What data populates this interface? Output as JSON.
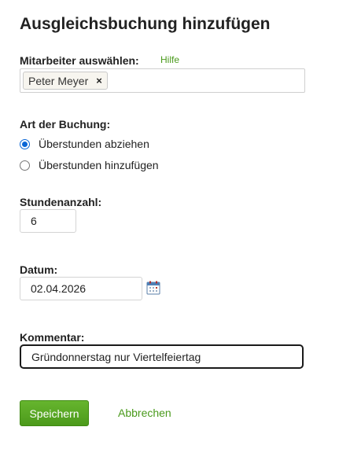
{
  "page": {
    "title": "Ausgleichsbuchung hinzufügen"
  },
  "employee": {
    "label": "Mitarbeiter auswählen:",
    "help_link": "Hilfe",
    "selected": [
      {
        "name": "Peter Meyer",
        "remove": "×"
      }
    ]
  },
  "booking_type": {
    "label": "Art der Buchung:",
    "options": [
      {
        "label": "Überstunden abziehen",
        "selected": true
      },
      {
        "label": "Überstunden hinzufügen",
        "selected": false
      }
    ]
  },
  "hours": {
    "label": "Stundenanzahl:",
    "value": "6"
  },
  "date": {
    "label": "Datum:",
    "value": "02.04.2026",
    "icon": "calendar-icon"
  },
  "comment": {
    "label": "Kommentar:",
    "value": "Gründonnerstag nur Viertelfeiertag"
  },
  "actions": {
    "save": "Speichern",
    "cancel": "Abbrechen"
  },
  "colors": {
    "accent_green": "#4a9a1c",
    "button_green": "#56a321",
    "radio_blue": "#0a66d6"
  }
}
